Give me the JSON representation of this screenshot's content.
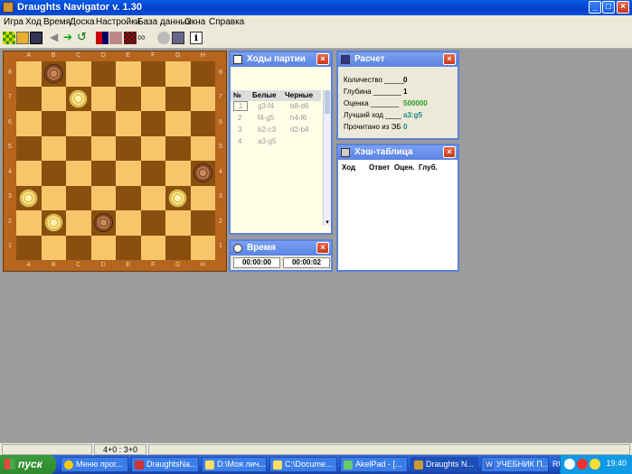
{
  "window": {
    "title": "Draughts Navigator v. 1.30"
  },
  "menu": [
    "Игра",
    "Ход",
    "Время",
    "Доска",
    "Настройки",
    "База данных",
    "Окна",
    "Справка"
  ],
  "board": {
    "files": [
      "A",
      "B",
      "C",
      "D",
      "E",
      "F",
      "G",
      "H"
    ],
    "ranks": [
      "8",
      "7",
      "6",
      "5",
      "4",
      "3",
      "2",
      "1"
    ],
    "pieces": [
      {
        "square": "b8",
        "color": "black"
      },
      {
        "square": "c7",
        "color": "white"
      },
      {
        "square": "h4",
        "color": "black"
      },
      {
        "square": "a3",
        "color": "white"
      },
      {
        "square": "g3",
        "color": "white"
      },
      {
        "square": "b2",
        "color": "white"
      },
      {
        "square": "d2",
        "color": "black"
      }
    ]
  },
  "moves_panel": {
    "title": "Ходы партии",
    "headers": {
      "num": "№",
      "white": "Белые",
      "black": "Черные"
    },
    "rows": [
      {
        "num": "1",
        "white": "g3-f4",
        "black": "b8-d6"
      },
      {
        "num": "2",
        "white": "f4-g5",
        "black": "h4-f6"
      },
      {
        "num": "3",
        "white": "b2-c3",
        "black": "d2-b4"
      },
      {
        "num": "4",
        "white": "a3-g5",
        "black": ""
      }
    ]
  },
  "calc_panel": {
    "title": "Расчет",
    "rows": [
      {
        "label": "Количество _____",
        "value": "0"
      },
      {
        "label": "Глубина _______",
        "value": "1"
      },
      {
        "label": "Оценка _______",
        "value": "500000"
      },
      {
        "label": "Лучший ход ____",
        "value": "a3:g5"
      },
      {
        "label": "Прочитано из ЭБ",
        "value": "0"
      }
    ]
  },
  "time_panel": {
    "title": "Время",
    "white_time": "00:00:00",
    "black_time": "00:00:02"
  },
  "hash_panel": {
    "title": "Хэш-таблица",
    "headers": {
      "move": "Ход",
      "answer": "Ответ",
      "eval": "Оцен.",
      "depth": "Глуб."
    }
  },
  "status": {
    "score": "4+0 : 3+0"
  },
  "taskbar": {
    "start": "пуск",
    "tasks": [
      "Меню прог...",
      "DraughtsNa...",
      "D:\\Моя лич...",
      "C:\\Docume...",
      "AkelPad - [...",
      "Draughts N...",
      "УЧЕБНИК П..."
    ],
    "lang": "RU",
    "clock": "19:40"
  },
  "colors": {
    "light_square": "#f7c66b",
    "dark_square": "#8a4f0e",
    "panel_border": "#5b82d8",
    "title_blue": "#0a52d9"
  }
}
